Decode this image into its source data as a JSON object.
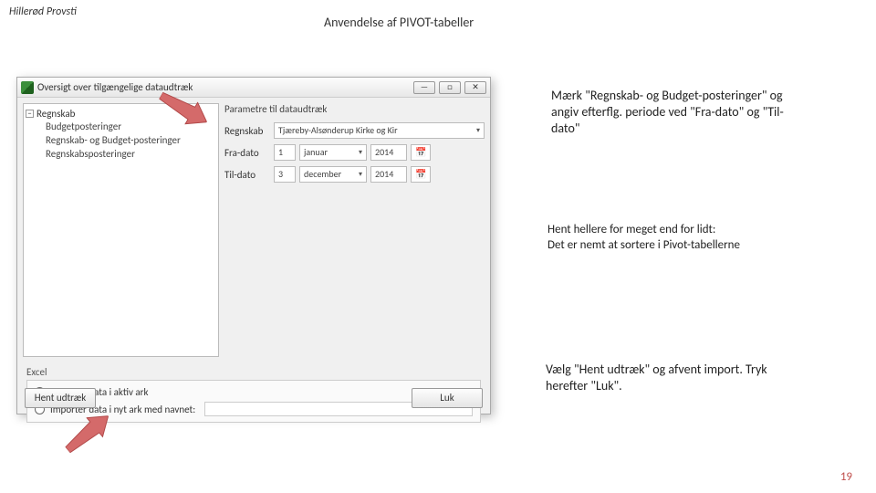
{
  "header": {
    "left": "Hillerød Provsti",
    "center": "Anvendelse af PIVOT-tabeller"
  },
  "dialog": {
    "title": "Oversigt over tilgængelige dataudtræk",
    "winbtns": {
      "min": "—",
      "max": "□",
      "close": "✕"
    },
    "tree": {
      "root": "Regnskab",
      "items": [
        "Budgetposteringer",
        "Regnskab- og Budget-posteringer",
        "Regnskabsposteringer"
      ]
    },
    "params": {
      "heading": "Parametre til dataudtræk",
      "regnskab_label": "Regnskab",
      "regnskab_value": "Tjæreby-Alsønderup Kirke og Kir",
      "fra_label": "Fra-dato",
      "fra": {
        "day": "1",
        "month": "januar",
        "year": "2014"
      },
      "til_label": "Til-dato",
      "til": {
        "day": "3",
        "month": "december",
        "year": "2014"
      }
    },
    "excel": {
      "group": "Excel",
      "opt1": "Importer data i aktiv ark",
      "opt2": "Importer data i nyt ark med navnet:"
    },
    "buttons": {
      "hent": "Hent udtræk",
      "luk": "Luk"
    }
  },
  "annotations": {
    "a1": "Mærk \"Regnskab- og Budget-posteringer\" og angiv efterflg. periode ved \"Fra-dato\" og \"Til-dato\"",
    "a2": "Hent hellere for meget end for lidt:\nDet er nemt at sortere i Pivot-tabellerne",
    "a3": "Vælg  \"Hent udtræk\" og afvent import. Tryk herefter \"Luk\"."
  },
  "page": "19"
}
